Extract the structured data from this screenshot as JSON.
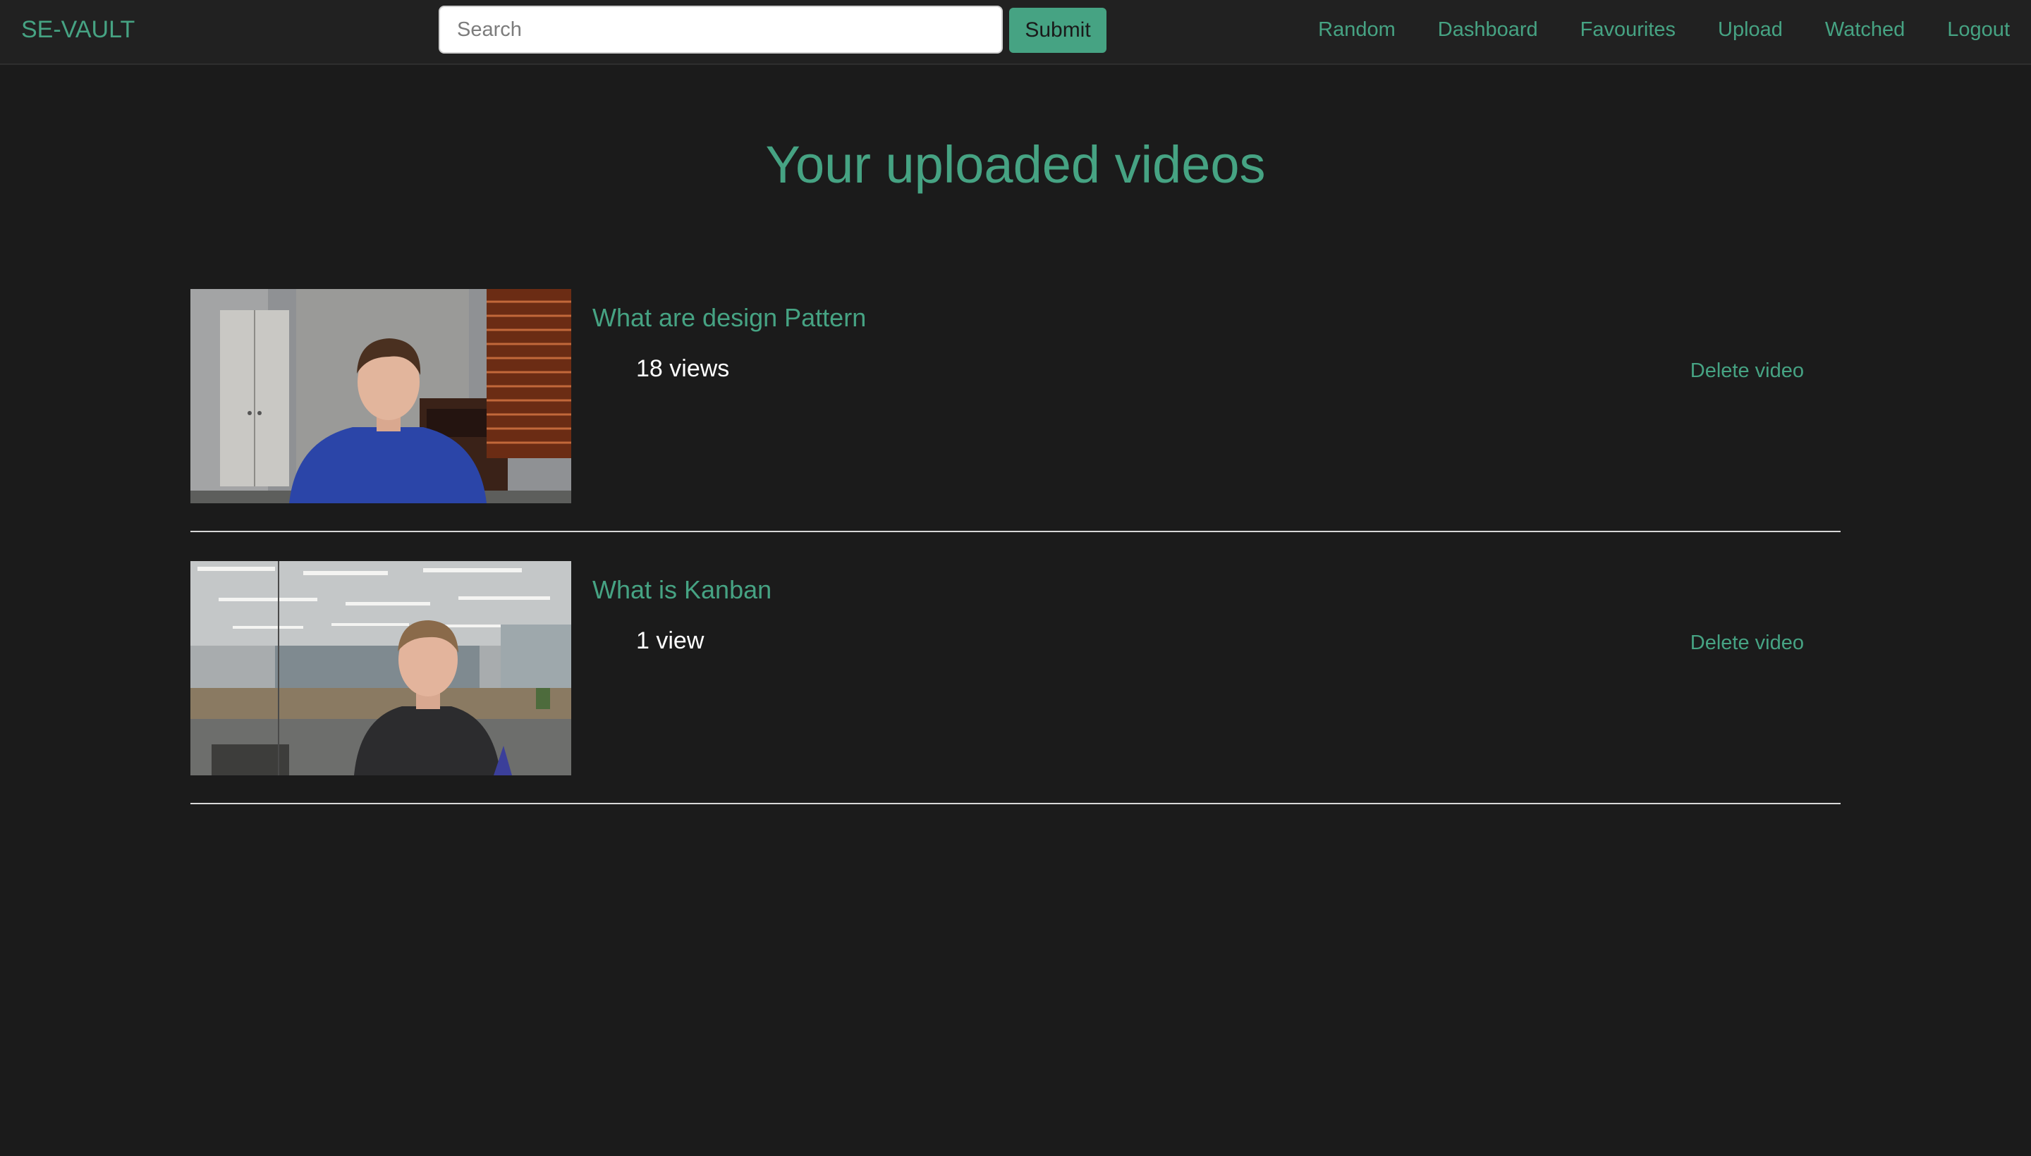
{
  "brand": "SE-VAULT",
  "search": {
    "placeholder": "Search",
    "value": "",
    "submit_label": "Submit"
  },
  "nav": [
    {
      "label": "Random"
    },
    {
      "label": "Dashboard"
    },
    {
      "label": "Favourites"
    },
    {
      "label": "Upload"
    },
    {
      "label": "Watched"
    },
    {
      "label": "Logout"
    }
  ],
  "page_title": "Your uploaded videos",
  "videos": [
    {
      "title": "What are design Pattern",
      "views": "18 views",
      "delete_label": "Delete video"
    },
    {
      "title": "What is Kanban",
      "views": "1 view",
      "delete_label": "Delete video"
    }
  ],
  "colors": {
    "accent": "#46a383",
    "background": "#1b1b1b",
    "navbar": "#212121"
  }
}
